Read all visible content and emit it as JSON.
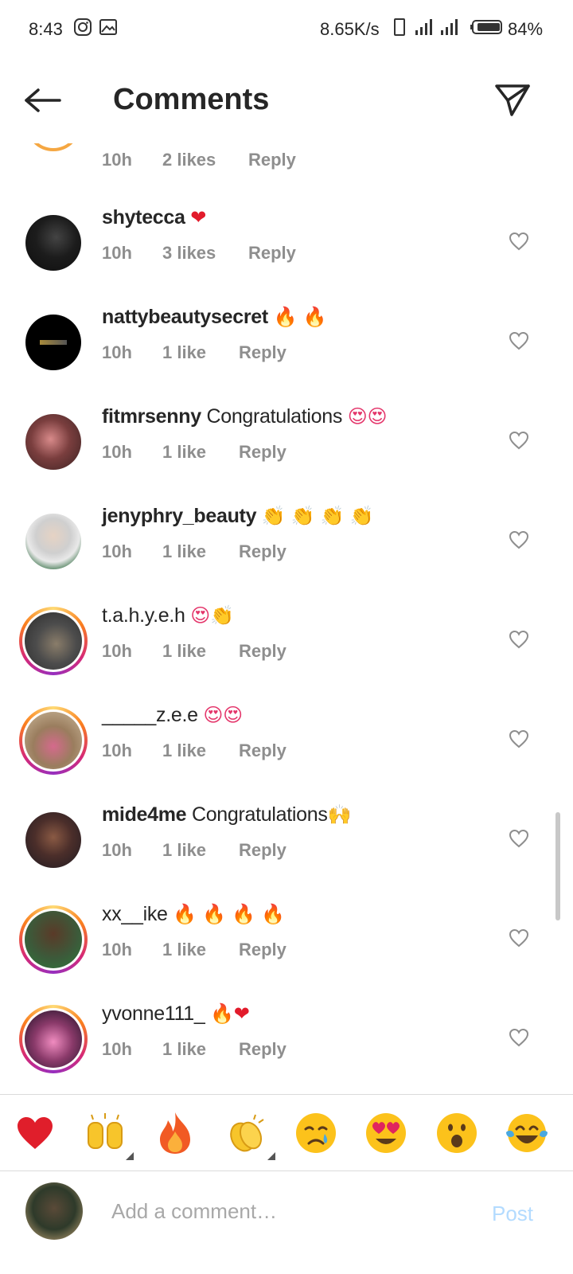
{
  "status_bar": {
    "time": "8:43",
    "network_speed": "8.65K/s",
    "battery": "84%",
    "icons": [
      "instagram-icon",
      "gallery-icon",
      "phone-outline-icon",
      "signal-icon",
      "signal-icon",
      "battery-icon"
    ]
  },
  "header": {
    "title": "Comments",
    "back_icon": "back-arrow-icon",
    "share_icon": "send-icon"
  },
  "partial_comment": {
    "time": "10h",
    "likes": "2 likes",
    "reply": "Reply"
  },
  "comments": [
    {
      "username": "shytecca",
      "text": "",
      "emoji": "❤",
      "time": "10h",
      "likes": "3 likes",
      "reply": "Reply",
      "story_ring": false
    },
    {
      "username": "nattybeautysecret",
      "text": "",
      "emoji": "🔥 🔥",
      "time": "10h",
      "likes": "1 like",
      "reply": "Reply",
      "story_ring": false
    },
    {
      "username": "fitmrsenny",
      "text": "Congratulations",
      "emoji": "😍😍",
      "time": "10h",
      "likes": "1 like",
      "reply": "Reply",
      "story_ring": false
    },
    {
      "username": "jenyphry_beauty",
      "text": "",
      "emoji": "👏 👏 👏 👏",
      "time": "10h",
      "likes": "1 like",
      "reply": "Reply",
      "story_ring": false
    },
    {
      "username": "t.a.h.y.e.h",
      "text": "",
      "emoji": "😍👏",
      "time": "10h",
      "likes": "1 like",
      "reply": "Reply",
      "story_ring": true
    },
    {
      "username": "_____z.e.e",
      "text": "",
      "emoji": "😍😍",
      "time": "10h",
      "likes": "1 like",
      "reply": "Reply",
      "story_ring": true
    },
    {
      "username": "mide4me",
      "text": "Congratulations",
      "emoji": "🙌",
      "time": "10h",
      "likes": "1 like",
      "reply": "Reply",
      "story_ring": false
    },
    {
      "username": "xx__ike",
      "text": "",
      "emoji": "🔥 🔥 🔥 🔥",
      "time": "10h",
      "likes": "1 like",
      "reply": "Reply",
      "story_ring": true
    },
    {
      "username": "yvonne111_",
      "text": "",
      "emoji": "🔥❤",
      "time": "10h",
      "likes": "1 like",
      "reply": "Reply",
      "story_ring": true
    }
  ],
  "emoji_bar": [
    {
      "name": "heart-emoji",
      "glyph": "❤",
      "has_skin_tone": false
    },
    {
      "name": "raised-hands-emoji",
      "glyph": "🙌",
      "has_skin_tone": true
    },
    {
      "name": "fire-emoji",
      "glyph": "🔥",
      "has_skin_tone": false
    },
    {
      "name": "clapping-hands-emoji",
      "glyph": "👏",
      "has_skin_tone": true
    },
    {
      "name": "crying-face-emoji",
      "glyph": "😢",
      "has_skin_tone": false
    },
    {
      "name": "heart-eyes-emoji",
      "glyph": "😍",
      "has_skin_tone": false
    },
    {
      "name": "surprised-face-emoji",
      "glyph": "😮",
      "has_skin_tone": false
    },
    {
      "name": "tears-of-joy-emoji",
      "glyph": "😂",
      "has_skin_tone": false
    }
  ],
  "composer": {
    "placeholder": "Add a comment…",
    "post_label": "Post"
  },
  "colors": {
    "text": "#262626",
    "meta": "#8e8e8e",
    "post_disabled": "#b3dbff",
    "heart_red": "#ed1c24"
  }
}
